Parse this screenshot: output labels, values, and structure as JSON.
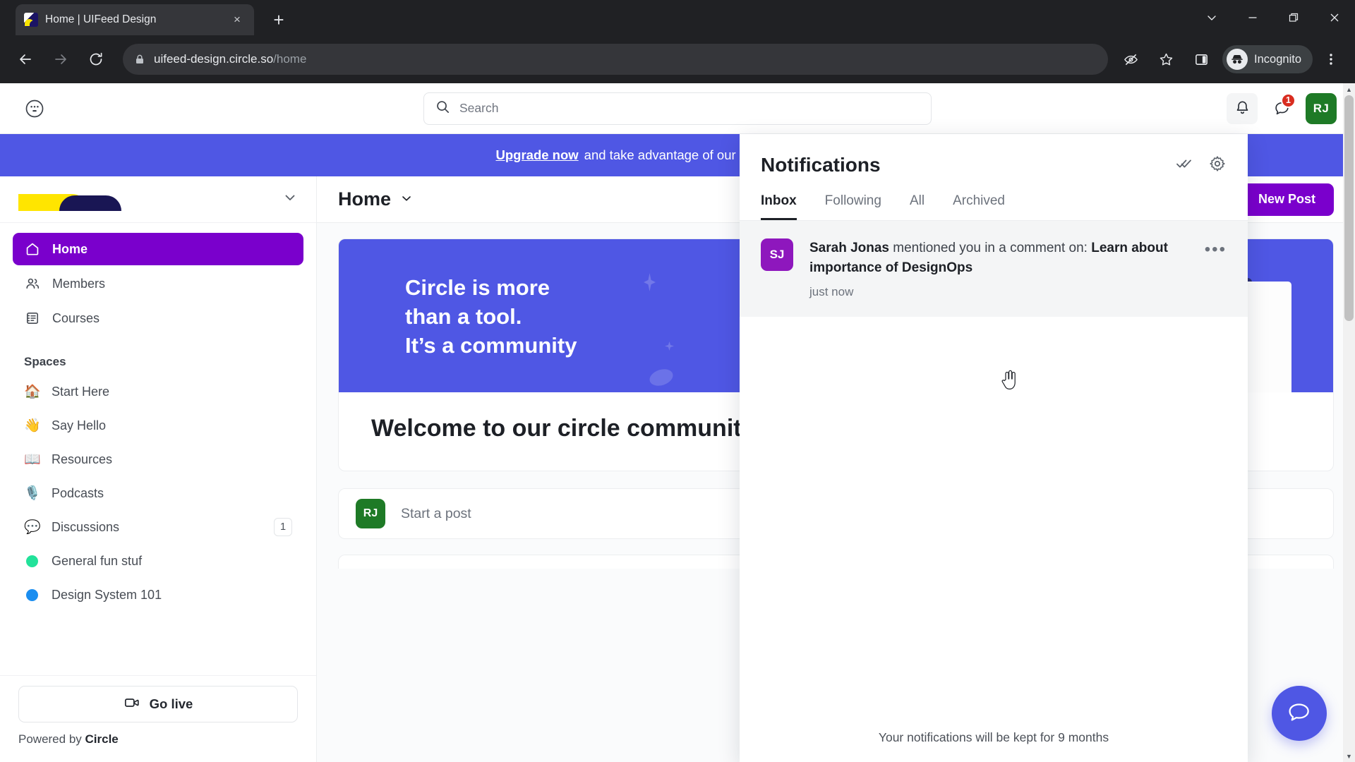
{
  "browser": {
    "tab": {
      "title": "Home | UIFeed Design",
      "close_label": "×"
    },
    "new_tab_label": "+",
    "url_host": "uifeed-design.circle.so",
    "url_path": "/home",
    "profile_label": "Incognito",
    "window_controls": {
      "minimize_group": "chevron-down",
      "minimize": "minimize",
      "maximize": "maximize",
      "close": "close"
    }
  },
  "app_header": {
    "search_placeholder": "Search",
    "messages_badge": "1",
    "user_initials": "RJ"
  },
  "banner": {
    "link_text": "Upgrade now",
    "message": "and take advantage of our annual plan discount"
  },
  "sidebar": {
    "nav": [
      {
        "label": "Home",
        "icon": "home-icon",
        "active": true
      },
      {
        "label": "Members",
        "icon": "members-icon",
        "active": false
      },
      {
        "label": "Courses",
        "icon": "courses-icon",
        "active": false
      }
    ],
    "section_label": "Spaces",
    "spaces": [
      {
        "label": "Start Here",
        "emoji": "🏠",
        "count": ""
      },
      {
        "label": "Say Hello",
        "emoji": "👋",
        "count": ""
      },
      {
        "label": "Resources",
        "emoji": "📖",
        "count": ""
      },
      {
        "label": "Podcasts",
        "emoji": "🎙️",
        "count": ""
      },
      {
        "label": "Discussions",
        "emoji": "💬",
        "count": "1"
      },
      {
        "label": "General fun stuf",
        "dot_color": "#22e29a",
        "count": ""
      },
      {
        "label": "Design System 101",
        "dot_color": "#1b8ef0",
        "count": ""
      }
    ],
    "go_live_label": "Go live",
    "powered_prefix": "Powered by ",
    "powered_brand": "Circle"
  },
  "main": {
    "page_title": "Home",
    "new_post_label": "New Post",
    "hero_line1": "Circle is more",
    "hero_line2": "than a tool.",
    "hero_line3": "It’s a community",
    "welcome_heading": "Welcome to our circle community",
    "composer_placeholder": "Start a post",
    "composer_initials": "RJ"
  },
  "notifications": {
    "title": "Notifications",
    "tabs": [
      {
        "label": "Inbox",
        "active": true
      },
      {
        "label": "Following",
        "active": false
      },
      {
        "label": "All",
        "active": false
      },
      {
        "label": "Archived",
        "active": false
      }
    ],
    "items": [
      {
        "initials": "SJ",
        "actor": "Sarah Jonas",
        "action": " mentioned you in a comment on: ",
        "target": "Learn about importance of DesignOps",
        "time": "just now",
        "more_label": "•••"
      }
    ],
    "footer": "Your notifications will be kept for 9 months"
  },
  "colors": {
    "brand_purple": "#7a00cc",
    "banner_blue": "#4f57e4",
    "avatar_green": "#1e7a26",
    "notif_avatar_purple": "#8e17bd",
    "badge_red": "#d92d20"
  }
}
